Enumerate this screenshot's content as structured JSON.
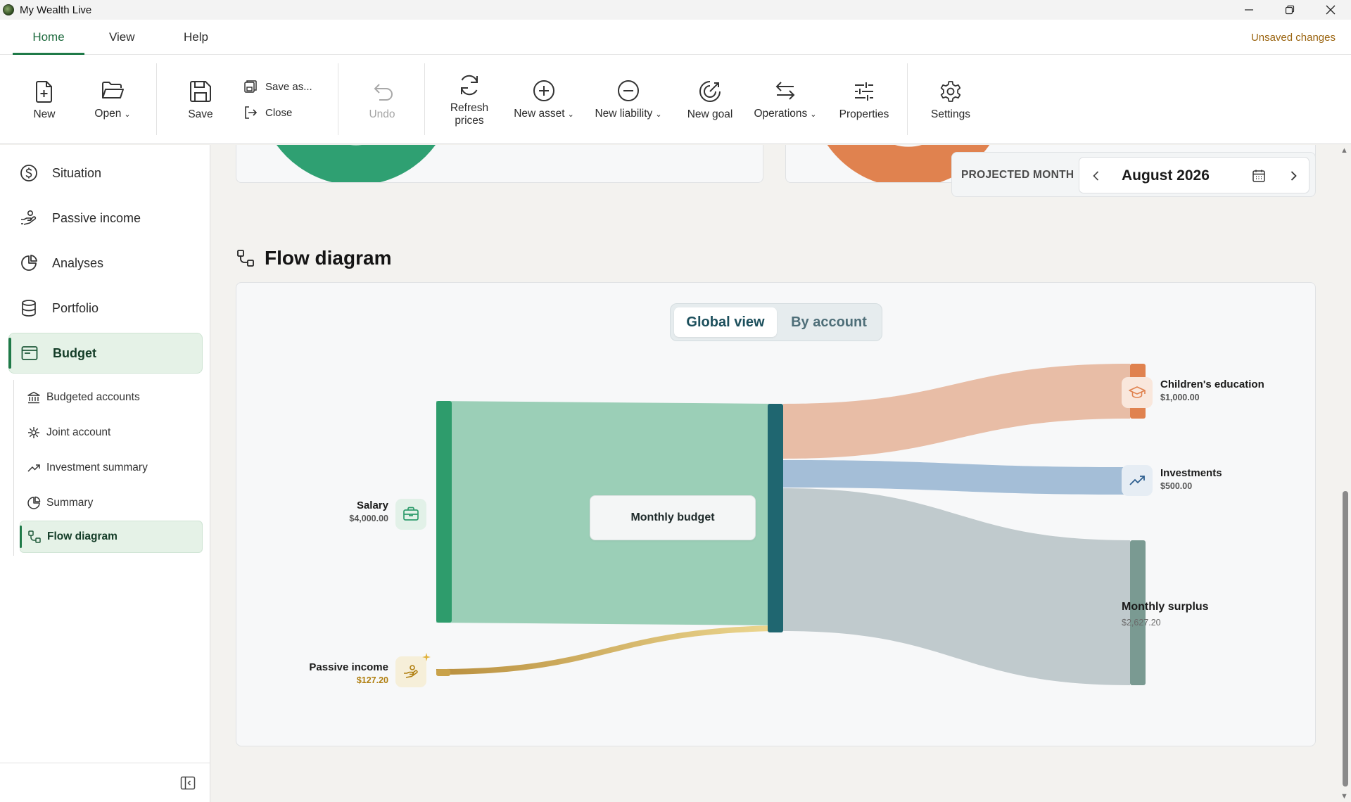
{
  "window": {
    "title": "My Wealth Live"
  },
  "tabs": [
    {
      "label": "Home",
      "active": true
    },
    {
      "label": "View"
    },
    {
      "label": "Help"
    }
  ],
  "status": {
    "unsaved": "Unsaved changes"
  },
  "toolbar": {
    "new": "New",
    "open": "Open",
    "save": "Save",
    "save_as": "Save as...",
    "close": "Close",
    "undo": "Undo",
    "refresh_line1": "Refresh",
    "refresh_line2": "prices",
    "new_asset": "New asset",
    "new_liability": "New liability",
    "new_goal": "New goal",
    "operations": "Operations",
    "properties": "Properties",
    "settings": "Settings"
  },
  "sidebar": {
    "items": [
      {
        "label": "Situation",
        "icon": "dollar-circle-icon"
      },
      {
        "label": "Passive income",
        "icon": "hand-coins-icon"
      },
      {
        "label": "Analyses",
        "icon": "pie-chart-icon"
      },
      {
        "label": "Portfolio",
        "icon": "database-icon"
      },
      {
        "label": "Budget",
        "icon": "wallet-icon",
        "active": true
      }
    ],
    "subitems": [
      {
        "label": "Budgeted accounts",
        "icon": "bank-icon"
      },
      {
        "label": "Joint account",
        "icon": "link-icon"
      },
      {
        "label": "Investment summary",
        "icon": "trend-icon"
      },
      {
        "label": "Summary",
        "icon": "pie-chart-icon"
      },
      {
        "label": "Flow diagram",
        "icon": "flow-icon",
        "active": true
      }
    ]
  },
  "projected": {
    "label": "PROJECTED MONTH",
    "value": "August 2026"
  },
  "section": {
    "title": "Flow diagram"
  },
  "view_toggle": {
    "global": "Global view",
    "by_account": "By account",
    "selected": "Global view"
  },
  "flow": {
    "center": "Monthly budget",
    "inflows": [
      {
        "name": "Salary",
        "amount": "$4,000.00",
        "color": "#2e9c6c"
      },
      {
        "name": "Passive income",
        "amount": "$127.20",
        "color": "#c9a24a"
      }
    ],
    "outflows": [
      {
        "name": "Children's education",
        "amount": "$1,000.00",
        "color": "#e0824f"
      },
      {
        "name": "Investments",
        "amount": "$500.00",
        "color": "#4a7eb5"
      },
      {
        "name": "Monthly surplus",
        "amount": "$2,627.20",
        "color": "#7a9a92"
      }
    ]
  },
  "colors": {
    "accent": "#1f7a48",
    "unsaved": "#9a6410",
    "budget_node": "#1f6670"
  }
}
